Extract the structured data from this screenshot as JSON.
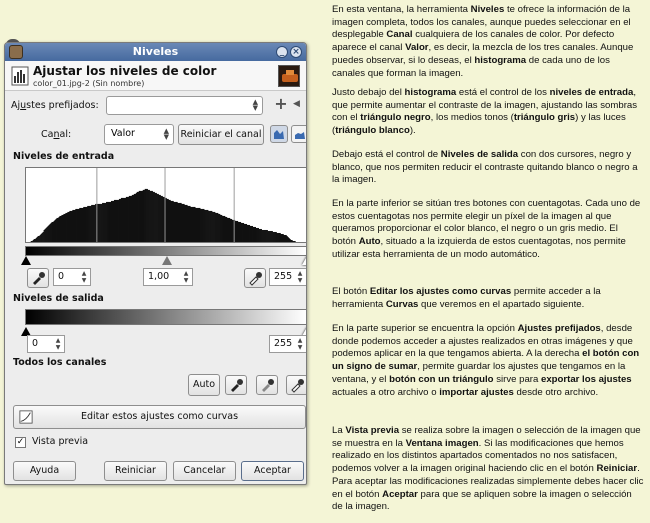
{
  "window": {
    "title": "Niveles",
    "header_title": "Ajustar los niveles de color",
    "header_subtitle": "color_01.jpg-2 (Sin nombre)"
  },
  "presets": {
    "label": "Ajustes prefijados:",
    "value": ""
  },
  "channel": {
    "label": "Canal:",
    "value": "Valor",
    "reset_label": "Reiniciar el canal"
  },
  "input_levels": {
    "label": "Niveles de entrada",
    "black_value": "0",
    "gamma_value": "1,00",
    "white_value": "255",
    "histogram": [
      0,
      0,
      1,
      1,
      2,
      3,
      3,
      4,
      5,
      6,
      6,
      7,
      8,
      9,
      10,
      12,
      13,
      14,
      15,
      16,
      17,
      18,
      19,
      20,
      20,
      21,
      22,
      23,
      24,
      24,
      25,
      26,
      26,
      27,
      27,
      28,
      28,
      29,
      29,
      30,
      30,
      31,
      31,
      31,
      32,
      32,
      32,
      33,
      33,
      33,
      33,
      34,
      34,
      34,
      34,
      35,
      35,
      35,
      35,
      36,
      36,
      36,
      36,
      37,
      37,
      37,
      37,
      38,
      38,
      38,
      38,
      38,
      38,
      38,
      39,
      39,
      39,
      39,
      40,
      40,
      40,
      40,
      40,
      41,
      41,
      41,
      42,
      42,
      42,
      42,
      42,
      43,
      43,
      44,
      44,
      44,
      44,
      44,
      45,
      45,
      45,
      46,
      46,
      46,
      47,
      47,
      48,
      48,
      49,
      50,
      50,
      51,
      51,
      51,
      51,
      52,
      52,
      53,
      53,
      53,
      52,
      52,
      51,
      51,
      51,
      50,
      50,
      49,
      49,
      48,
      48,
      47,
      47,
      46,
      46,
      45,
      45,
      44,
      44,
      43,
      43,
      42,
      42,
      41,
      41,
      41,
      40,
      40,
      40,
      40,
      39,
      39,
      39,
      39,
      38,
      38,
      38,
      37,
      37,
      37,
      36,
      36,
      36,
      35,
      35,
      35,
      35,
      35,
      34,
      34,
      34,
      34,
      34,
      33,
      33,
      33,
      33,
      32,
      32,
      32,
      32,
      31,
      31,
      31,
      31,
      30,
      30,
      30,
      29,
      29,
      29,
      28,
      28,
      27,
      27,
      26,
      26,
      26,
      25,
      25,
      24,
      24,
      24,
      23,
      23,
      22,
      22,
      22,
      21,
      21,
      21,
      20,
      20,
      20,
      19,
      19,
      19,
      18,
      18,
      18,
      17,
      17,
      17,
      16,
      16,
      16,
      15,
      15,
      15,
      14,
      14,
      14,
      13,
      13,
      13,
      12,
      12,
      12,
      12,
      12,
      12,
      11,
      11,
      11,
      11,
      11,
      10,
      10,
      10,
      10,
      9,
      9,
      9,
      9,
      8,
      8,
      8,
      7,
      7,
      7,
      6,
      5,
      4,
      3,
      2,
      2,
      1,
      1,
      1,
      0,
      0,
      0,
      0,
      0,
      0,
      0,
      0
    ]
  },
  "output_levels": {
    "label": "Niveles de salida",
    "black_value": "0",
    "white_value": "255"
  },
  "all_channels": {
    "label": "Todos los canales",
    "auto_label": "Auto"
  },
  "curves_button": {
    "label": "Editar estos ajustes como curvas"
  },
  "preview": {
    "label": "Vista previa",
    "checked": true
  },
  "buttons": {
    "help": "Ayuda",
    "reset": "Reiniciar",
    "cancel": "Cancelar",
    "ok": "Aceptar"
  },
  "article": [
    {
      "text": "En esta ventana, la herramienta <b>Niveles</b> te ofrece la información de la imagen completa, todos los canales, aunque puedes seleccionar en el desplegable <b>Canal</b> cualquiera de los canales de color. Por defecto aparece el canal <b>Valor</b>, es decir, la mezcla de los tres canales. Aunque puedes observar, si lo deseas, el <b>histograma</b> de cada uno de los canales que forman la imagen."
    },
    {
      "text": "Justo debajo del <b>histograma</b> está el control de los <b>niveles de entrada</b>, que permite aumentar el contraste de la imagen, ajustando las sombras con el <b>triángulo negro</b>, los medios tonos (<b>triángulo gris</b>) y las luces (<b>triángulo blanco</b>)."
    },
    {
      "text": "Debajo está el control de <b>Niveles de salida</b> con dos cursores, negro y blanco, que nos permiten reducir el contraste quitando blanco o negro a la imagen."
    },
    {
      "text": "En la parte inferior se sitúan tres botones con cuentagotas. Cada uno de estos cuentagotas nos permite elegir un píxel de la imagen al que queramos proporcionar el color blanco, el negro o un gris medio. El botón <b>Auto</b>, situado a la izquierda de estos cuentagotas, nos permite utilizar esta herramienta de un modo automático."
    },
    {
      "text": "El botón <b>Editar los ajustes como curvas</b> permite acceder a la herramienta <b>Curvas</b> que veremos en el apartado siguiente."
    },
    {
      "text": "En la parte superior se encuentra la opción <b>Ajustes prefijados</b>, desde donde podemos acceder a ajustes realizados en otras imágenes y que podemos aplicar en la que tengamos abierta. A la derecha <b>el botón con un signo de sumar</b>, permite guardar los ajustes que tengamos en la ventana, y el <b>botón con un triángulo</b> sirve para <b>exportar los ajustes</b> actuales a otro archivo o <b>importar ajustes</b> desde otro archivo."
    },
    {
      "text": "La <b>Vista previa</b> se realiza sobre la imagen o selección de la imagen que se muestra en la <b>Ventana imagen</b>. Si las modificaciones que hemos realizado en los distintos apartados comentados no nos satisfacen, podemos volver a la imagen original haciendo clic en el botón <b>Reiniciar</b>. Para aceptar las modificaciones realizadas simplemente debes hacer clic en el botón <b>Aceptar</b> para que se apliquen sobre la imagen o selección de la imagen."
    }
  ]
}
